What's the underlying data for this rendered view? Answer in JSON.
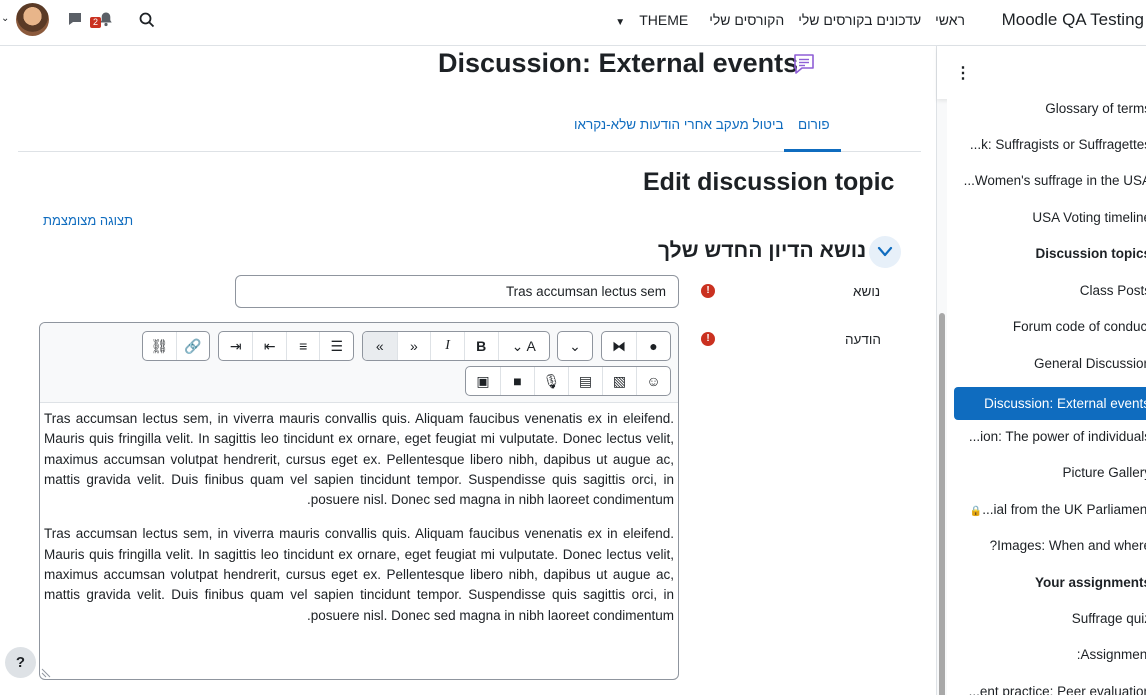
{
  "navbar": {
    "brand": "Moodle QA Testing",
    "links": [
      "ראשי",
      "עדכונים בקורסים שלי",
      "הקורסים שלי",
      "THEME"
    ],
    "notification_count": "2"
  },
  "drawer": {
    "items": [
      {
        "label": "Glossary of terms",
        "bold": false
      },
      {
        "label": "...k: Suffragists or Suffragettes",
        "bold": false
      },
      {
        "label": "...Women's suffrage in the USA",
        "bold": false
      },
      {
        "label": "USA Voting timeline",
        "bold": false
      },
      {
        "label": "Discussion topics",
        "bold": true
      },
      {
        "label": "Class Posts",
        "bold": false
      },
      {
        "label": "Forum code of conduct",
        "bold": false
      },
      {
        "label": "General Discussion",
        "bold": false
      },
      {
        "label": "Discussion: External events",
        "bold": false,
        "active": true
      },
      {
        "label": "...ion: The power of individuals",
        "bold": false
      },
      {
        "label": "Picture Gallery",
        "bold": false
      },
      {
        "label": "...ial from the UK Parliament",
        "bold": false,
        "locked": true
      },
      {
        "label": "?Images: When and where",
        "bold": false
      },
      {
        "label": "Your assignments",
        "bold": true
      },
      {
        "label": "Suffrage quiz",
        "bold": false
      },
      {
        "label": ":Assignment",
        "bold": false
      },
      {
        "label": "...ent practice: Peer evaluation",
        "bold": false
      }
    ]
  },
  "main": {
    "page_title": "Discussion: External events",
    "tabs": {
      "forum": "פורום",
      "unsubscribe": "ביטול מעקב אחרי הודעות שלא-נקראו"
    },
    "edit_heading": "Edit discussion topic",
    "collapse_link": "תצוגה מצומצמת",
    "section_title": "נושא הדיון החדש שלך",
    "subject_label": "נושא",
    "subject_value": "Tras accumsan lectus sem",
    "message_label": "הודעה",
    "paragraph": "Tras accumsan lectus sem, in viverra mauris convallis quis. Aliquam faucibus venenatis ex in eleifend. Mauris quis fringilla velit. In sagittis leo tincidunt ex ornare, eget feugiat mi vulputate. Donec lectus velit, maximus accumsan volutpat hendrerit, cursus eget ex. Pellentesque libero nibh, dapibus ut augue ac, mattis gravida velit. Duis finibus quam vel sapien tincidunt tempor. Suspendisse quis sagittis orci, in posuere nisl. Donec sed magna in nibh laoreet condimentum."
  },
  "help_label": "?"
}
